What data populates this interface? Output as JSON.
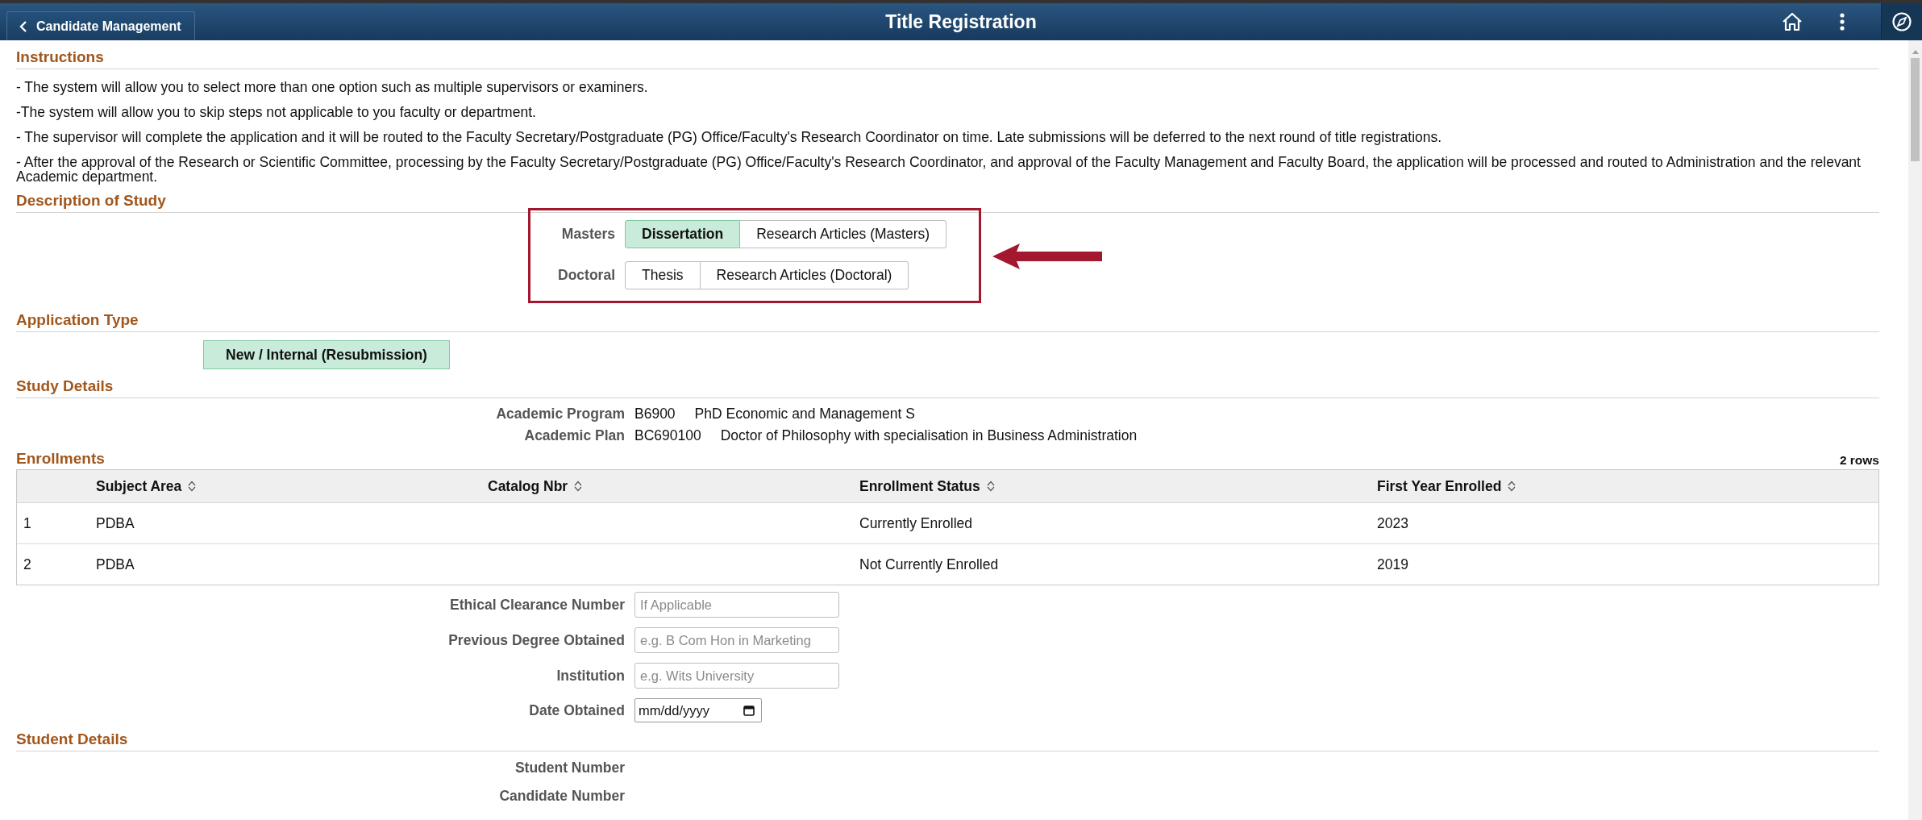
{
  "header": {
    "back_button": "Candidate Management",
    "title": "Title Registration"
  },
  "instructions": {
    "heading": "Instructions",
    "lines": [
      "- The system will allow you to select more than one option such as multiple supervisors or examiners.",
      "-The system will allow you to skip steps not applicable to you faculty or department.",
      "- The supervisor will complete the application and it will be routed to the Faculty Secretary/Postgraduate (PG) Office/Faculty's Research Coordinator on time. Late submissions will be deferred to the next round of title registrations.",
      "- After the approval of the Research or Scientific Committee, processing by the Faculty Secretary/Postgraduate (PG) Office/Faculty's Research Coordinator, and approval of the Faculty Management and Faculty Board, the application will be processed and routed to Administration and the relevant Academic department."
    ]
  },
  "description_of_study": {
    "heading": "Description of Study",
    "groups": [
      {
        "label": "Masters",
        "options": [
          {
            "label": "Dissertation",
            "selected": true
          },
          {
            "label": "Research Articles (Masters)",
            "selected": false
          }
        ]
      },
      {
        "label": "Doctoral",
        "options": [
          {
            "label": "Thesis",
            "selected": false
          },
          {
            "label": "Research Articles (Doctoral)",
            "selected": false
          }
        ]
      }
    ]
  },
  "application_type": {
    "heading": "Application Type",
    "options": [
      {
        "label": "New / Internal (Resubmission)",
        "selected": true
      }
    ]
  },
  "study_details": {
    "heading": "Study Details",
    "fields": [
      {
        "label": "Academic Program",
        "code": "B6900",
        "description": "PhD Economic and Management S"
      },
      {
        "label": "Academic Plan",
        "code": "BC690100",
        "description": "Doctor of Philosophy with specialisation in Business Administration"
      }
    ]
  },
  "enrollments": {
    "heading": "Enrollments",
    "row_count": "2 rows",
    "columns": [
      "Subject Area",
      "Catalog Nbr",
      "Enrollment Status",
      "First Year Enrolled"
    ],
    "rows": [
      {
        "row_number": "1",
        "subject_area": "PDBA",
        "enrollment_status": "Currently Enrolled",
        "first_year_enrolled": "2023"
      },
      {
        "row_number": "2",
        "subject_area": "PDBA",
        "enrollment_status": "Not Currently Enrolled",
        "first_year_enrolled": "2019"
      }
    ]
  },
  "form_fields": [
    {
      "label": "Ethical Clearance Number",
      "placeholder": "If Applicable",
      "kind": "text"
    },
    {
      "label": "Previous Degree Obtained",
      "placeholder": "e.g. B Com Hon in Marketing",
      "kind": "text"
    },
    {
      "label": "Institution",
      "placeholder": "e.g. Wits University",
      "kind": "text"
    },
    {
      "label": "Date Obtained",
      "placeholder": "mm/dd/yyyy",
      "kind": "date"
    }
  ],
  "student_details": {
    "heading": "Student Details",
    "fields": [
      {
        "label": "Student Number"
      },
      {
        "label": "Candidate Number"
      }
    ]
  }
}
